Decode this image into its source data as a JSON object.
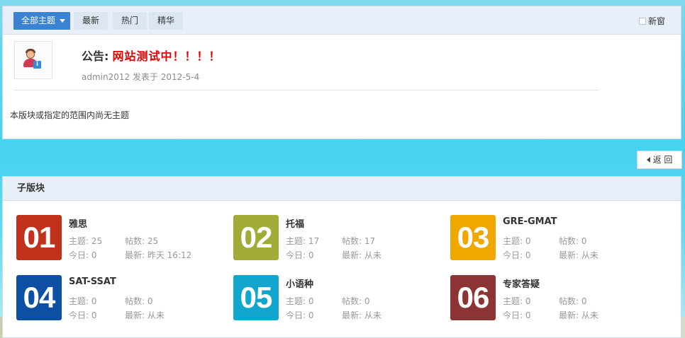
{
  "filter_bar": {
    "all_topics_label": "全部主题",
    "latest_label": "最新",
    "hot_label": "热门",
    "digest_label": "精华",
    "new_window_label": "新窗"
  },
  "announcement": {
    "label": "公告:",
    "message": "网站测试中！！！！",
    "meta": "admin2012 发表于  2012-5-4"
  },
  "empty_message": "本版块或指定的范围内尚无主题",
  "back_label": "返 回",
  "subforums": {
    "title": "子版块",
    "items": [
      {
        "num": "01",
        "color": "#c0321c",
        "name": "雅思",
        "topics": "主题: 25",
        "posts": "帖数: 25",
        "today": "今日: 0",
        "latest": "最新: 昨天 16:12"
      },
      {
        "num": "02",
        "color": "#a1ac38",
        "name": "托福",
        "topics": "主题: 17",
        "posts": "帖数: 17",
        "today": "今日: 0",
        "latest": "最新: 从未"
      },
      {
        "num": "03",
        "color": "#f0a800",
        "name": "GRE-GMAT",
        "topics": "主题: 0",
        "posts": "帖数: 0",
        "today": "今日: 0",
        "latest": "最新: 从未"
      },
      {
        "num": "04",
        "color": "#0d4fa3",
        "name": "SAT-SSAT",
        "topics": "主题: 0",
        "posts": "帖数: 0",
        "today": "今日: 0",
        "latest": "最新: 从未"
      },
      {
        "num": "05",
        "color": "#12a6cf",
        "name": "小语种",
        "topics": "主题: 0",
        "posts": "帖数: 0",
        "today": "今日: 0",
        "latest": "最新: 从未"
      },
      {
        "num": "06",
        "color": "#8c3434",
        "name": "专家答疑",
        "topics": "主题: 0",
        "posts": "帖数: 0",
        "today": "今日: 0",
        "latest": "最新: 从未"
      }
    ]
  }
}
